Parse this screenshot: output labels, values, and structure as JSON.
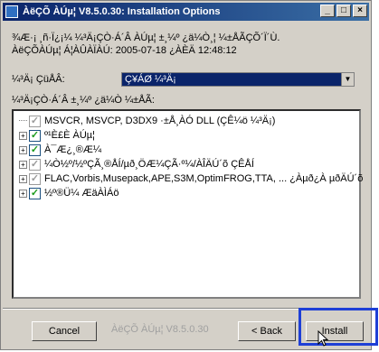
{
  "window": {
    "title": "ÀëÇÕ ÀÚµ¦ V8.5.0.30: Installation Options"
  },
  "title_buttons": {
    "minimize": "_",
    "maximize": "□",
    "close": "×"
  },
  "description": {
    "line1": "¾Æ·¡ ¸ñ·Ï¿¡¼­ ¼³Ä¡ÇÒ·Á´Â ÀÚµ¦ ±¸¼º ¿ä¼Ò¸¦ ¼±ÅÃÇÕ´Ï´Ù.",
    "line2": "ÀëÇÕÀÚµ¦ Á¦ÀÛÀÏÀÚ: 2005-07-18 ¿ÀÈÄ 12:48:12"
  },
  "labels": {
    "install_type": "¼³Ä¡ ÇüÅÂ:",
    "components": "¼³Ä¡ÇÒ·Á´Â ±¸¼º ¿ä¼Ò ¼±ÅÃ:"
  },
  "combo": {
    "value": "Ç¥ÁØ ¼³Ä¡"
  },
  "tree_items": [
    {
      "label": "MSVCR, MSVCP, D3DX9 ·±Å¸ÀÓ DLL (ÇÊ¼ö ¼³Ä¡)",
      "expander": "",
      "checked": true,
      "greyed": true
    },
    {
      "label": "º¹È£È­ ÀÚµ¦",
      "expander": "+",
      "checked": true,
      "greyed": false
    },
    {
      "label": "À¯Æ¿¸®Æ¼",
      "expander": "+",
      "checked": true,
      "greyed": false
    },
    {
      "label": "¼Ò½º/½ºÇÃ¸®ÅÍ/µð¸ÖÆ¼ÇÃ·º¼­/ÀÎÄÚ´õ ÇÊÅÍ",
      "expander": "+",
      "checked": true,
      "greyed": true
    },
    {
      "label": "FLAC,Vorbis,Musepack,APE,S3M,OptimFROG,TTA, ... ¿Àµð¿À µðÄÚ´õ",
      "expander": "+",
      "checked": true,
      "greyed": true
    },
    {
      "label": "½º®Ü¼­ ÆäÀÌÁö",
      "expander": "+",
      "checked": true,
      "greyed": false
    }
  ],
  "buttons": {
    "cancel": "Cancel",
    "back": "< Back",
    "install": "Install"
  },
  "branding": "ÀëÇÕ ÀÚµ¦ V8.5.0.30",
  "colors": {
    "title_bar": "#0a246a",
    "highlight_box": "#1e3fd6",
    "check": "#1a9a1a"
  }
}
